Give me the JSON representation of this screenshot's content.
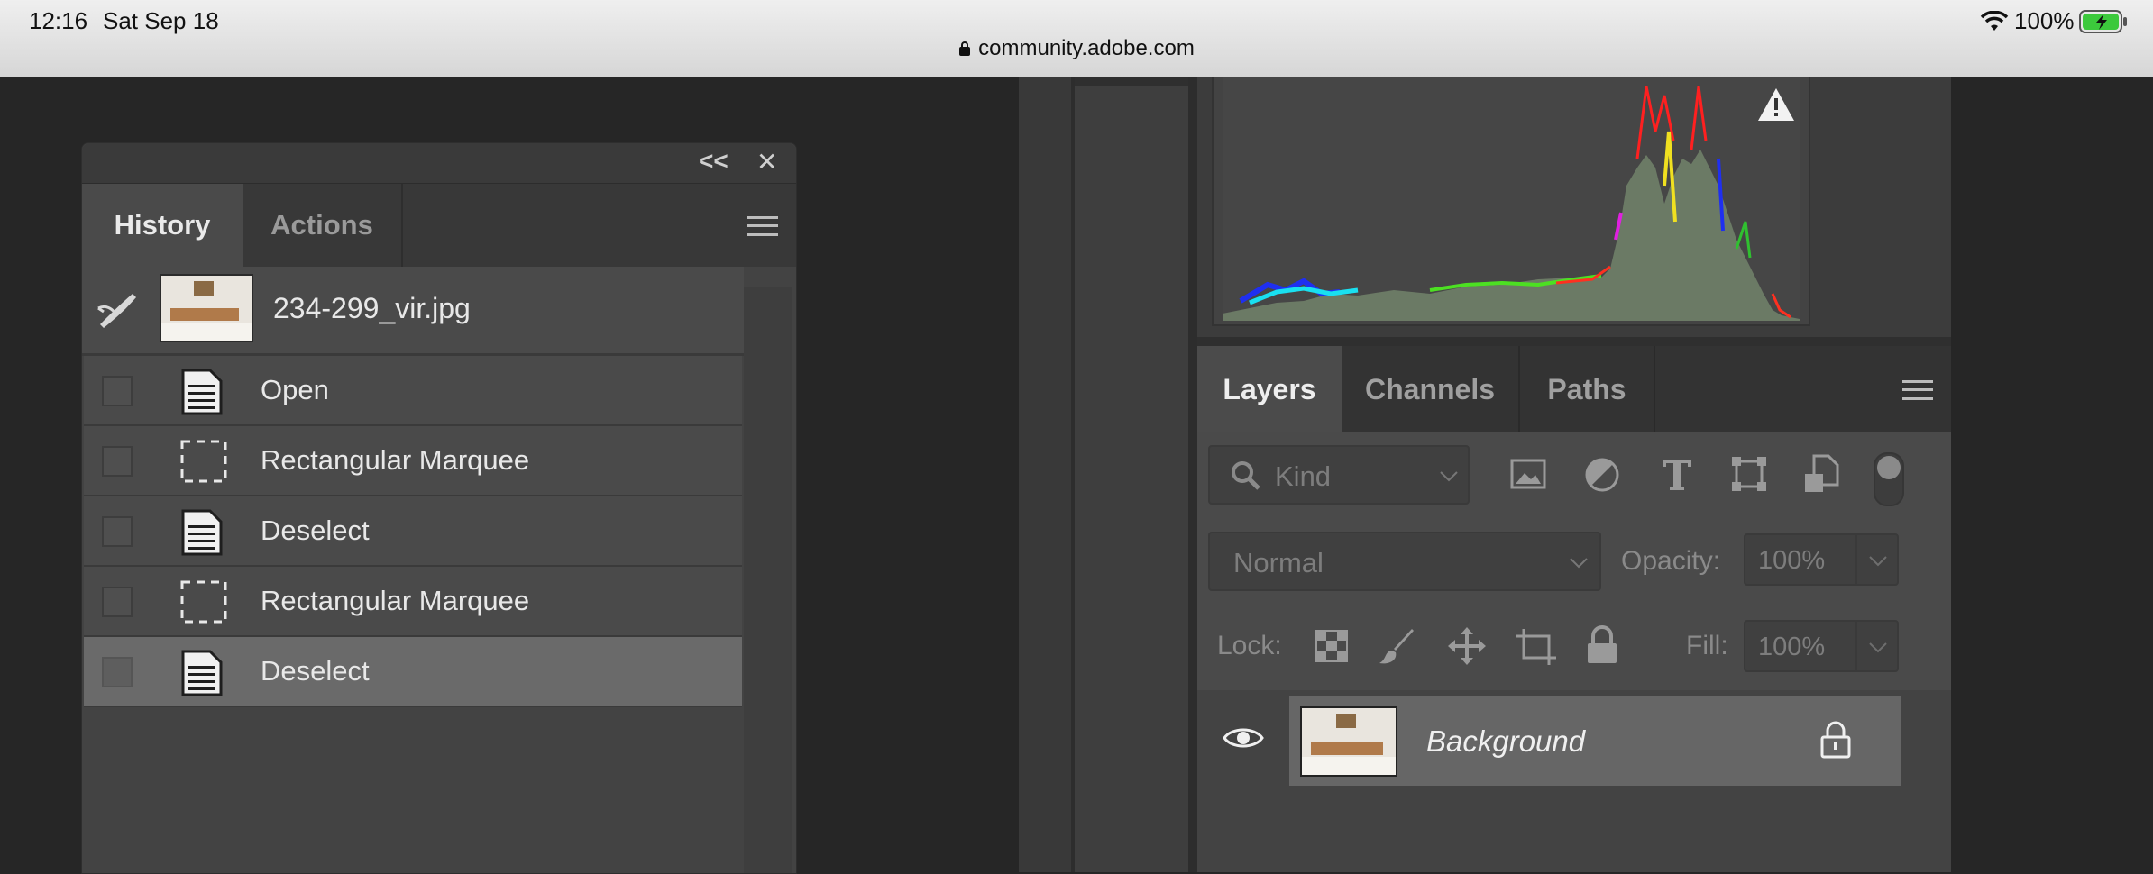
{
  "status_bar": {
    "time": "12:16",
    "date": "Sat Sep 18",
    "url": "community.adobe.com",
    "battery": "100%"
  },
  "history_panel": {
    "collapse_glyph": "<<",
    "close_glyph": "✕",
    "tabs": [
      {
        "label": "History",
        "active": true
      },
      {
        "label": "Actions",
        "active": false
      }
    ],
    "snapshot_name": "234-299_vir.jpg",
    "items": [
      {
        "label": "Open",
        "icon": "document-icon",
        "selected": false
      },
      {
        "label": "Rectangular Marquee",
        "icon": "marquee-icon",
        "selected": false
      },
      {
        "label": "Deselect",
        "icon": "document-icon",
        "selected": false
      },
      {
        "label": "Rectangular Marquee",
        "icon": "marquee-icon",
        "selected": false
      },
      {
        "label": "Deselect",
        "icon": "document-icon",
        "selected": true
      }
    ]
  },
  "layers_panel": {
    "tabs": [
      {
        "label": "Layers",
        "active": true
      },
      {
        "label": "Channels",
        "active": false
      },
      {
        "label": "Paths",
        "active": false
      }
    ],
    "filter_placeholder": "Kind",
    "blend_mode": "Normal",
    "opacity_label": "Opacity:",
    "opacity_value": "100%",
    "lock_label": "Lock:",
    "fill_label": "Fill:",
    "fill_value": "100%",
    "layers": [
      {
        "name": "Background",
        "visible": true,
        "locked": true
      }
    ]
  },
  "colors": {
    "panel_bg": "#434343",
    "selected_row": "#6a6a6a",
    "histogram_fill": "#6b7a65"
  }
}
